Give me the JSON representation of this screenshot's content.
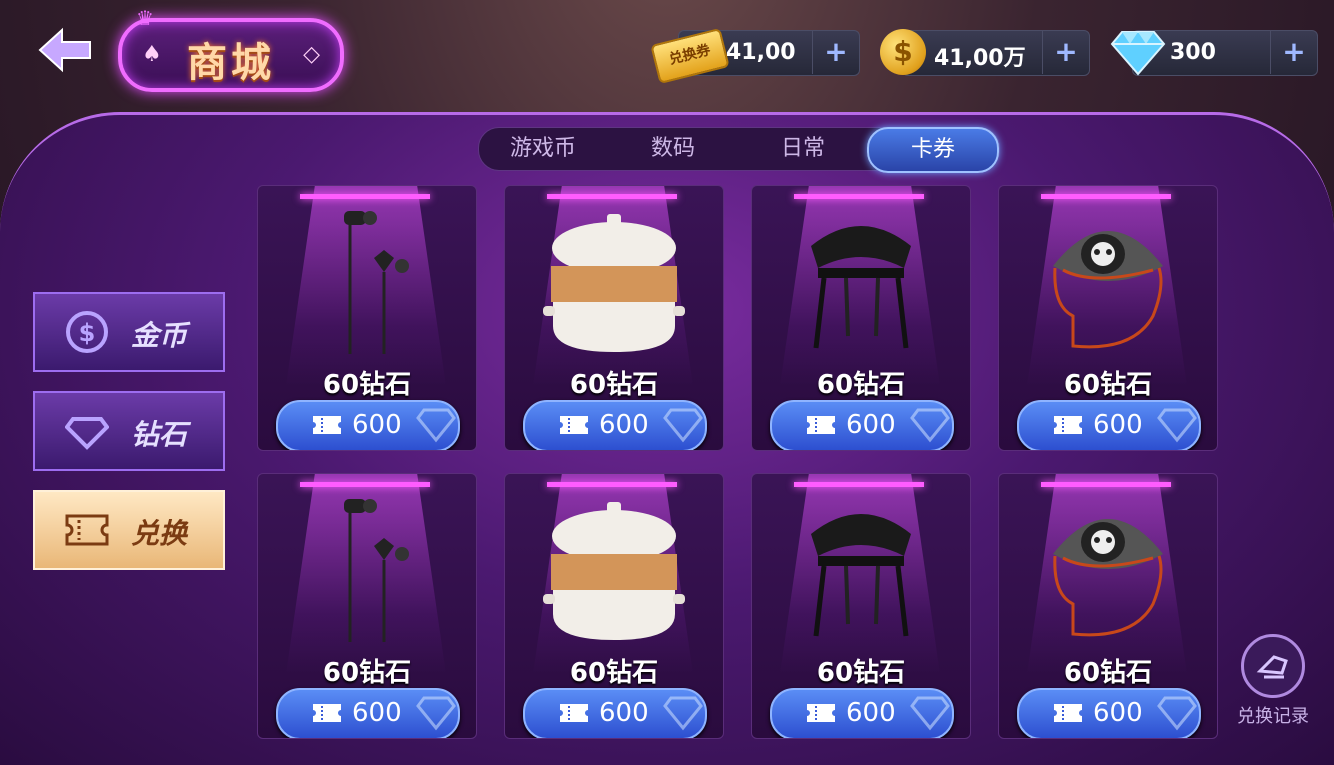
{
  "header": {
    "title": "商城",
    "resources": [
      {
        "icon": "exchange-ticket-icon",
        "icon_label": "兑换券",
        "value": "41,00"
      },
      {
        "icon": "gold-coin-icon",
        "icon_label": "$",
        "value": "41,00万"
      },
      {
        "icon": "diamond-icon",
        "value": "300"
      }
    ],
    "plus": "+"
  },
  "tabs": [
    {
      "label": "游戏币",
      "active": false
    },
    {
      "label": "数码",
      "active": false
    },
    {
      "label": "日常",
      "active": false
    },
    {
      "label": "卡券",
      "active": true
    }
  ],
  "sidebar": [
    {
      "label": "金币",
      "icon": "coin-icon",
      "active": false
    },
    {
      "label": "钻石",
      "icon": "diamond-icon",
      "active": false
    },
    {
      "label": "兑换",
      "icon": "ticket-icon",
      "active": true
    }
  ],
  "products": [
    {
      "item": "earphones",
      "title": "60钻石",
      "cost": "600"
    },
    {
      "item": "steamer-pot",
      "title": "60钻石",
      "cost": "600"
    },
    {
      "item": "chair",
      "title": "60钻石",
      "cost": "600"
    },
    {
      "item": "pet-bed",
      "title": "60钻石",
      "cost": "600"
    },
    {
      "item": "earphones",
      "title": "60钻石",
      "cost": "600"
    },
    {
      "item": "steamer-pot",
      "title": "60钻石",
      "cost": "600"
    },
    {
      "item": "chair",
      "title": "60钻石",
      "cost": "600"
    },
    {
      "item": "pet-bed",
      "title": "60钻石",
      "cost": "600"
    }
  ],
  "record_button": {
    "label": "兑换记录"
  },
  "colors": {
    "accent": "#f06cff",
    "button_blue": "#3d63e0",
    "active_gold": "#e9b777"
  }
}
